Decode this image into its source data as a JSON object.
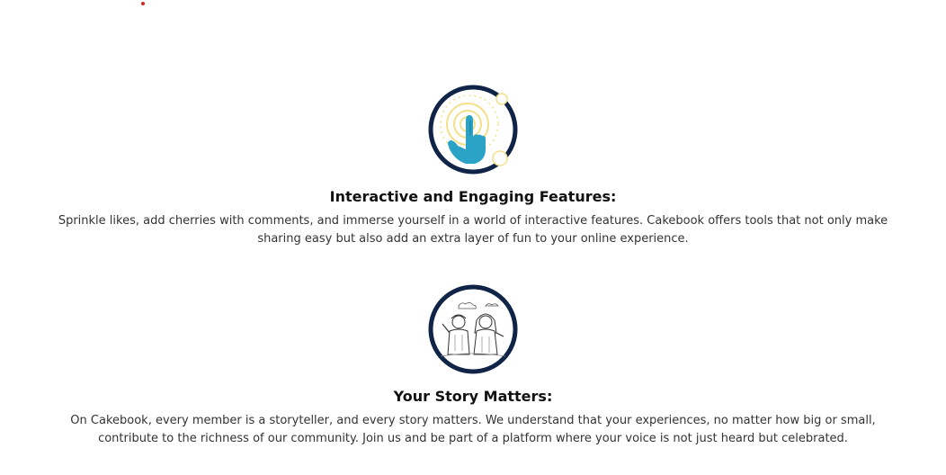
{
  "features": [
    {
      "icon": "hand-tap-icon",
      "title": "Interactive and Engaging Features:",
      "text": "Sprinkle likes, add cherries with comments, and immerse yourself in a world of interactive features. Cakebook offers tools that not only make sharing easy but also add an extra layer of fun to your online experience."
    },
    {
      "icon": "storytellers-icon",
      "title": "Your Story Matters:",
      "text": "On Cakebook, every member is a storyteller, and every story matters. We understand that your experiences, no matter how big or small, contribute to the richness of our community. Join us and be part of a platform where your voice is not just heard but celebrated."
    }
  ],
  "colors": {
    "circle_border": "#0f2447",
    "hand": "#2aa3c7",
    "ripple": "#f3e08a",
    "accent_dot": "#d62828"
  }
}
